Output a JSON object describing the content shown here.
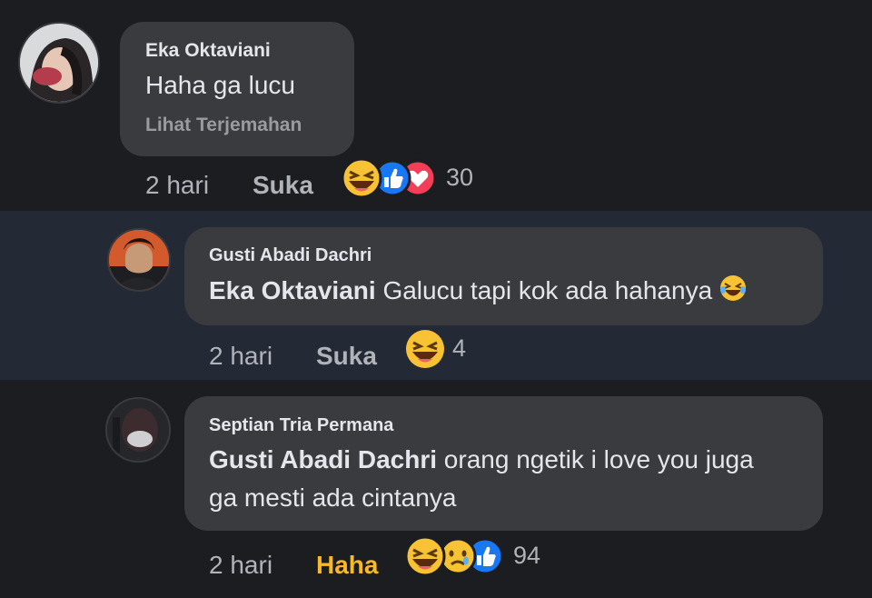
{
  "colors": {
    "background": "#1c1d21",
    "highlight_row": "#232935",
    "bubble": "#3a3b3e",
    "haha_active": "#f7b928",
    "like_blue": "#1877f2",
    "love_red": "#f33e58"
  },
  "comments": [
    {
      "author": "Eka Oktaviani",
      "text": "Haha ga lucu",
      "translate_label": "Lihat Terjemahan",
      "time": "2 hari",
      "action_label": "Suka",
      "reactions": [
        "haha-icon",
        "like-icon",
        "love-icon"
      ],
      "reaction_count": "30"
    },
    {
      "author": "Gusti Abadi Dachri",
      "mention": "Eka Oktaviani",
      "text": "Galucu tapi kok ada hahanya",
      "inline_emoji": "laughing-tears-emoji",
      "time": "2 hari",
      "action_label": "Suka",
      "reactions": [
        "haha-icon"
      ],
      "reaction_count": "4"
    },
    {
      "author": "Septian Tria Permana",
      "mention": "Gusti Abadi Dachri",
      "text_line1": "orang ngetik i love you juga",
      "text_line2": "ga mesti ada cintanya",
      "time": "2 hari",
      "action_label": "Haha",
      "reactions": [
        "haha-icon",
        "sad-icon",
        "like-icon"
      ],
      "reaction_count": "94"
    }
  ]
}
